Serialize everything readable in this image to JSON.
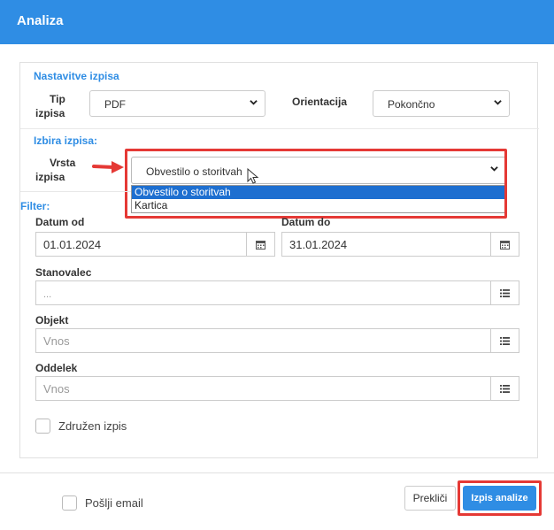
{
  "header": {
    "title": "Analiza"
  },
  "settings": {
    "section_title": "Nastavitve izpisa",
    "tip_label_1": "Tip",
    "tip_label_2": "izpisa",
    "tip_value": "PDF",
    "orientation_label": "Orientacija",
    "orientation_value": "Pokončno"
  },
  "selection": {
    "section_title": "Izbira izpisa:",
    "vrsta_label_1": "Vrsta",
    "vrsta_label_2": "izpisa",
    "vrsta_value": "Obvestilo o storitvah",
    "options": [
      "Obvestilo o storitvah",
      "Kartica"
    ]
  },
  "filter": {
    "section_title": "Filter:",
    "date_from_label": "Datum od",
    "date_from_value": "01.01.2024",
    "date_to_label": "Datum do",
    "date_to_value": "31.01.2024",
    "stanovalec_label": "Stanovalec",
    "stanovalec_placeholder": "...",
    "objekt_label": "Objekt",
    "objekt_placeholder": "Vnos",
    "oddelek_label": "Oddelek",
    "oddelek_placeholder": "Vnos",
    "combined_label": "Združen izpis"
  },
  "footer": {
    "email_label": "Pošlji email",
    "cancel_label": "Prekliči",
    "submit_label": "Izpis analize"
  },
  "colors": {
    "accent": "#2f8de4",
    "highlight": "#e53935",
    "option_selected": "#1e6fd0"
  }
}
